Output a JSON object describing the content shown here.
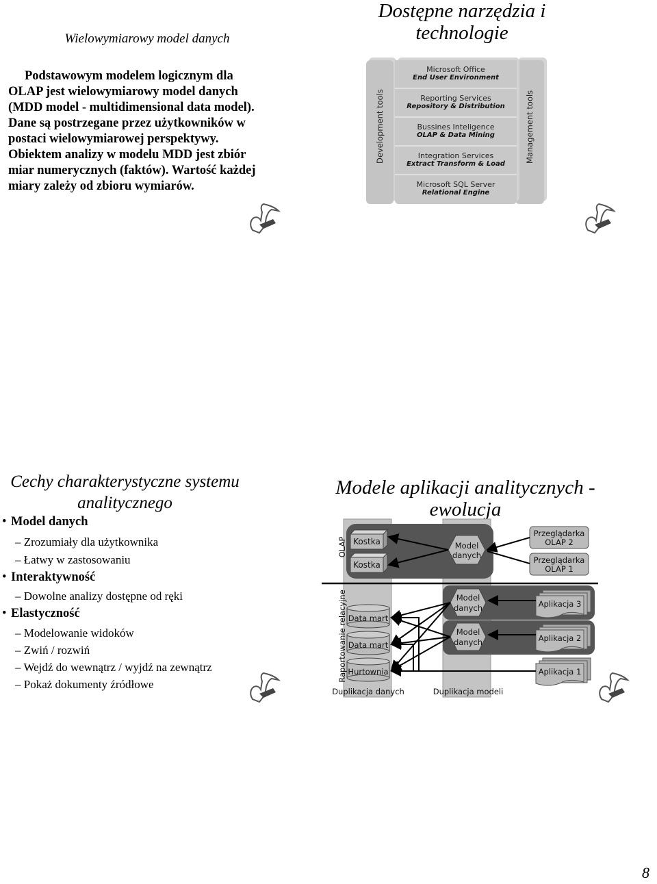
{
  "slide1": {
    "title": "Wielowymiarowy model danych",
    "paragraph_lines": [
      "Podstawowym modelem logicznym dla",
      "OLAP jest wielowymiarowy model danych",
      "(MDD model - multidimensional data model).",
      "Dane są postrzegane przez użytkowników w",
      "postaci wielowymiarowej perspektywy.",
      "Obiektem analizy w modelu MDD jest zbiór",
      "miar numerycznych (faktów). Wartość każdej",
      "miary zależy od zbioru wymiarów."
    ]
  },
  "slide2": {
    "title_line1": "Dostępne narzędzia i",
    "title_line2": "technologie",
    "left_column": "Development tools",
    "right_column": "Management tools",
    "layers": [
      {
        "name": "Microsoft Office",
        "sub": "End User Environment"
      },
      {
        "name": "Reporting Services",
        "sub": "Repository & Distribution"
      },
      {
        "name": "Bussines Inteligence",
        "sub": "OLAP & Data Mining"
      },
      {
        "name": "Integration Services",
        "sub": "Extract Transform & Load"
      },
      {
        "name": "Microsoft SQL Server",
        "sub": "Relational Engine"
      }
    ]
  },
  "slide3": {
    "title_line1": "Cechy charakterystyczne systemu",
    "title_line2": "analitycznego",
    "items": [
      {
        "level": 1,
        "text": "Model danych"
      },
      {
        "level": 2,
        "text": "– Zrozumiały dla użytkownika"
      },
      {
        "level": 2,
        "text": "– Łatwy w zastosowaniu"
      },
      {
        "level": 1,
        "text": "Interaktywność"
      },
      {
        "level": 2,
        "text": "– Dowolne analizy dostępne od ręki"
      },
      {
        "level": 1,
        "text": "Elastyczność"
      },
      {
        "level": 2,
        "text": "– Modelowanie widoków"
      },
      {
        "level": 2,
        "text": "– Zwiń / rozwiń"
      },
      {
        "level": 2,
        "text": "– Wejdź do wewnątrz / wyjdź na zewnątrz"
      },
      {
        "level": 2,
        "text": "– Pokaż dokumenty źródłowe"
      }
    ]
  },
  "slide4": {
    "title_line1": "Modele aplikacji analitycznych -",
    "title_line2": "ewolucja",
    "olap_label": "OLAP",
    "relational_label": "Raportowanie relacyjne",
    "cube1": "Kostka",
    "cube2": "Kostka",
    "model_line1": "Model",
    "model_line2": "danych",
    "browser2_l1": "Przeglądarka",
    "browser2_l2": "OLAP 2",
    "browser1_l1": "Przeglądarka",
    "browser1_l2": "OLAP 1",
    "datamart1": "Data mart",
    "datamart2": "Data mart",
    "warehouse": "Hurtownia",
    "app3": "Aplikacja 3",
    "app2": "Aplikacja 2",
    "app1": "Aplikacja 1",
    "dup_data": "Duplikacja danych",
    "dup_models": "Duplikacja modeli"
  },
  "page_number": "8"
}
